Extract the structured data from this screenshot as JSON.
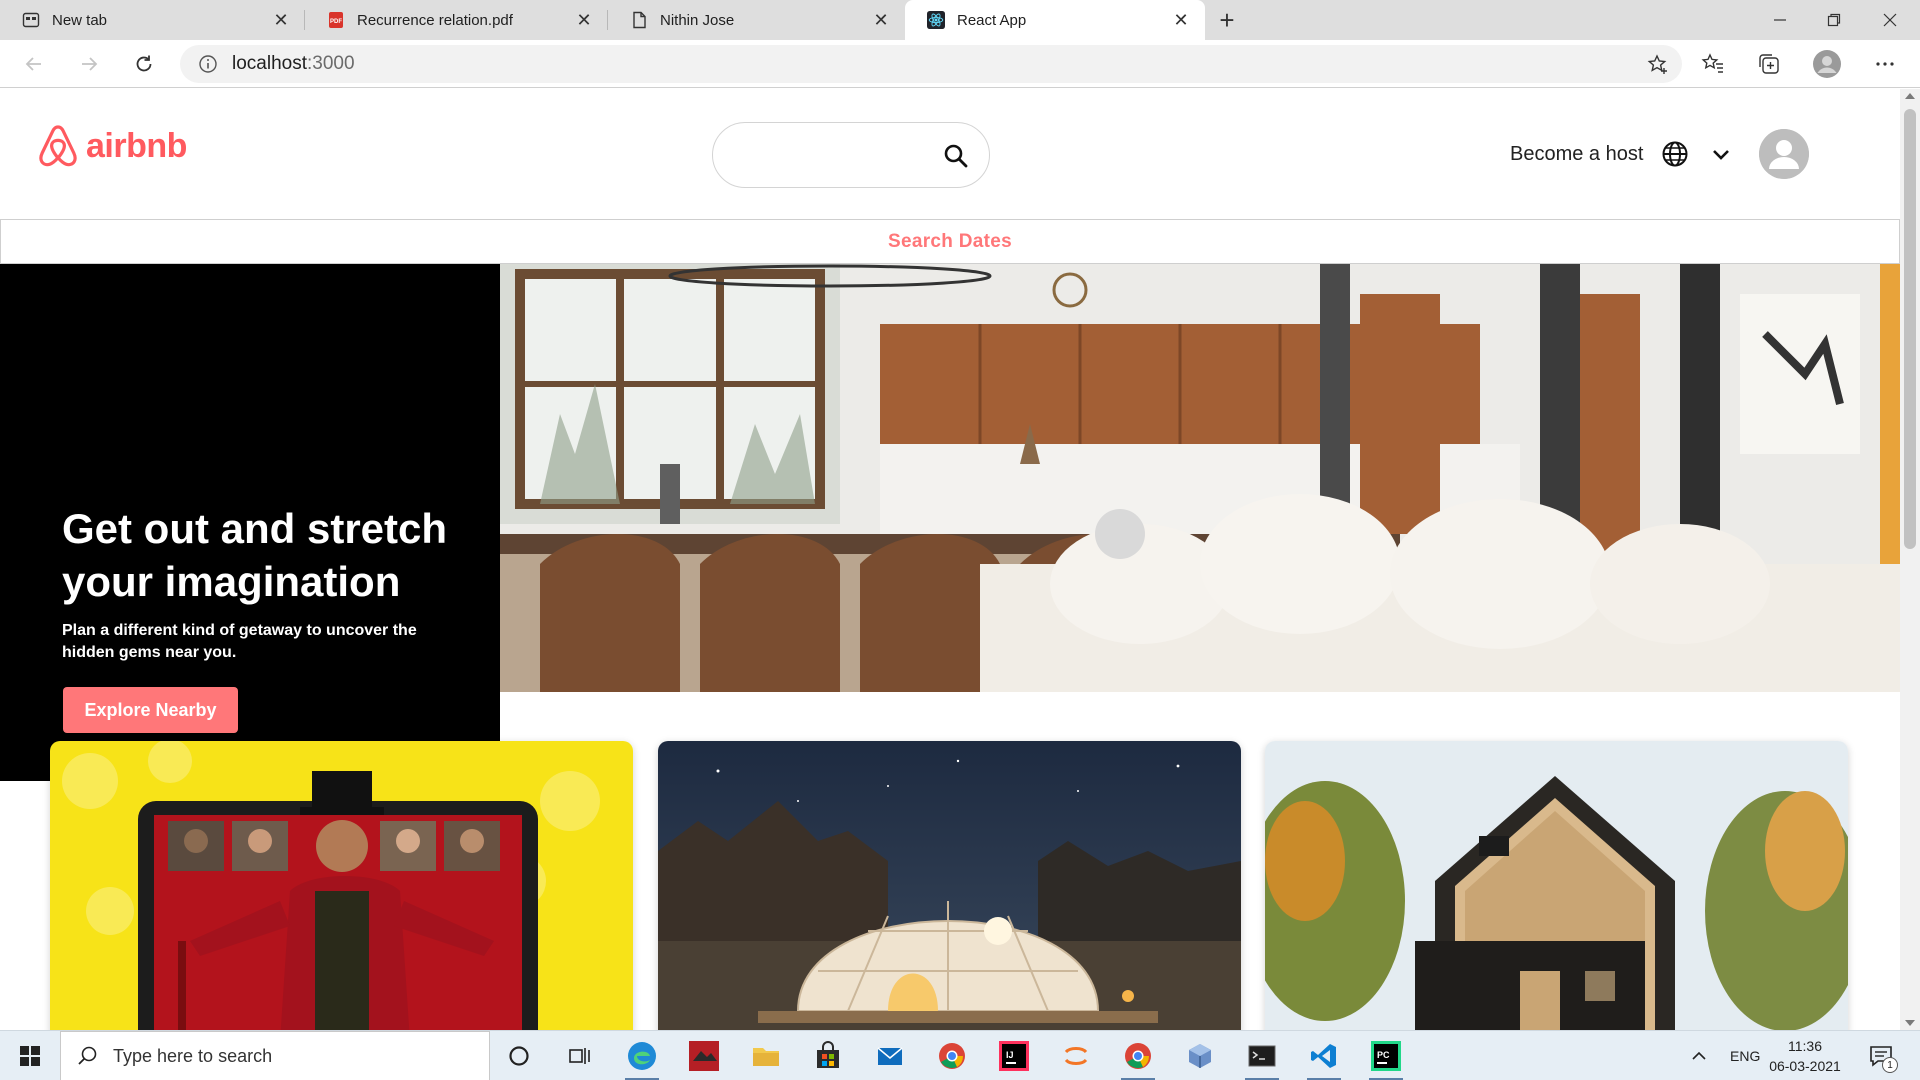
{
  "browser": {
    "tabs": [
      {
        "title": "New tab",
        "icon": "newtab-icon",
        "active": false
      },
      {
        "title": "Recurrence relation.pdf",
        "icon": "pdf-icon",
        "active": false
      },
      {
        "title": "Nithin Jose",
        "icon": "document-icon",
        "active": false
      },
      {
        "title": "React App",
        "icon": "react-icon",
        "active": true
      }
    ],
    "url": {
      "host": "localhost",
      "port": ":3000"
    }
  },
  "header": {
    "logo_text": "airbnb",
    "search_placeholder": "",
    "host_link": "Become a host"
  },
  "dates_bar": {
    "label": "Search Dates"
  },
  "hero": {
    "headline": "Get out and stretch your imagination",
    "subtext": "Plan a different kind of getaway to uncover the hidden gems near you.",
    "cta": "Explore Nearby"
  },
  "cards": [
    {
      "image": "online-experiences-photo"
    },
    {
      "image": "dome-tent-night-photo"
    },
    {
      "image": "wooden-cabin-photo"
    }
  ],
  "taskbar": {
    "search_placeholder": "Type here to search",
    "language": "ENG",
    "time": "11:36",
    "date": "06-03-2021",
    "notification_count": "1"
  },
  "colors": {
    "brand": "#ff5a5f",
    "accent": "#ff7779",
    "promo_bg": "#000000"
  }
}
